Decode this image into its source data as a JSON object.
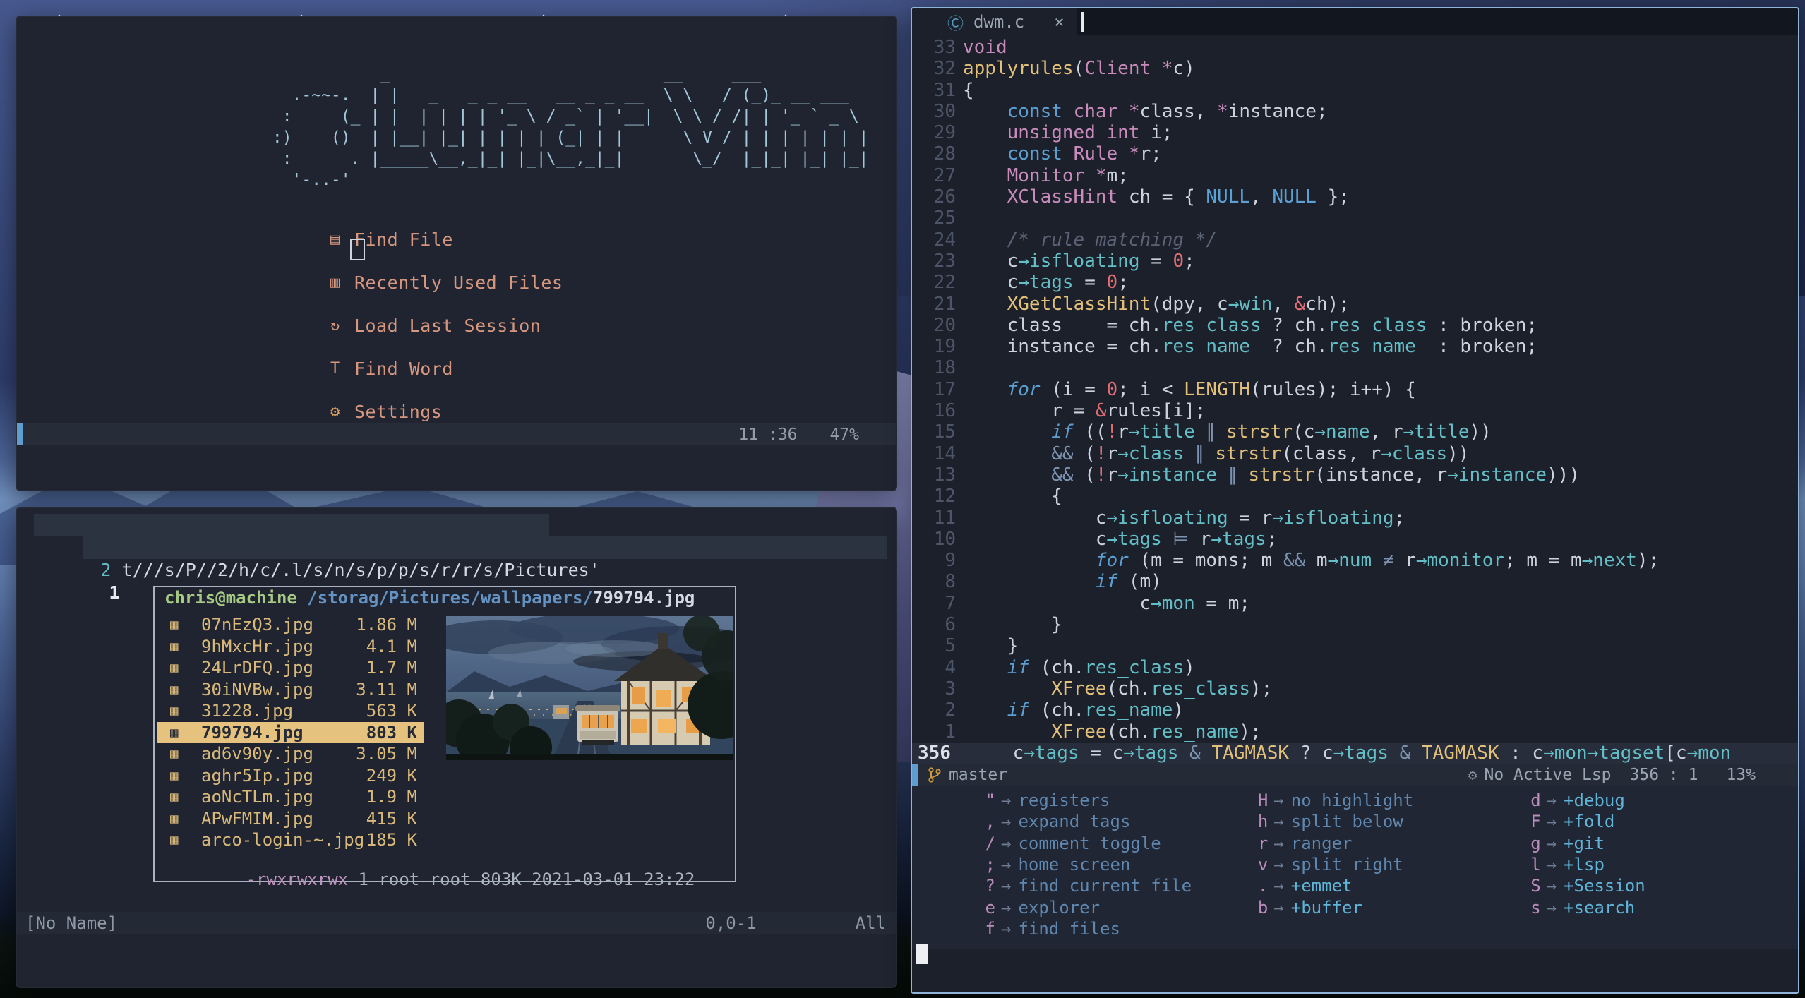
{
  "dashboard": {
    "art": "            _                            __     ___\n   .-~~-.  | |   _   _ _ __   __ _ _ __  \\ \\   / (_)_ __ ___\n  :     (_ | |  | | | | '_ \\ / _` | '__|  \\ \\ / /| | '_ ` _ \\\n :)    ()  | |__| |_| | | | | (_| | |      \\ V / | | | | | | |\n  :      . |_____\\__,_|_| |_|\\__,_|_|       \\_/  |_|_| |_| |_|\n   '-..-'",
    "menu": [
      {
        "id": "find-file",
        "icon": "▤",
        "label": "Find File"
      },
      {
        "id": "recent-files",
        "icon": "▥",
        "label": "Recently Used Files"
      },
      {
        "id": "load-session",
        "icon": "↻",
        "label": "Load Last Session"
      },
      {
        "id": "find-word",
        "icon": "T",
        "label": "Find Word"
      },
      {
        "id": "settings",
        "icon": "⚙",
        "label": "Settings",
        "icon_color": "#d9a05f"
      }
    ],
    "statusbar": {
      "time": "11 :36",
      "scroll": "47%"
    }
  },
  "terminal": {
    "row2": {
      "num": "2",
      "text": "t///s/P//2/h/c/.l/s/n/s/p/p/s/r/r/s/Pictures'"
    },
    "row1": {
      "num": "1"
    },
    "ranger": {
      "user": "chris@machine",
      "path": " /storag/Pictures/wallpapers/",
      "file": "799794.jpg",
      "file_icon": "▦",
      "entries": [
        {
          "name": "07nEzQ3.jpg",
          "size": "1.86 M"
        },
        {
          "name": "9hMxcHr.jpg",
          "size": "4.1 M"
        },
        {
          "name": "24LrDFQ.jpg",
          "size": "1.7 M"
        },
        {
          "name": "30iNVBw.jpg",
          "size": "3.11 M"
        },
        {
          "name": "31228.jpg",
          "size": "563 K"
        },
        {
          "name": "799794.jpg",
          "size": "803 K",
          "selected": true
        },
        {
          "name": "ad6v90y.jpg",
          "size": "3.05 M"
        },
        {
          "name": "aghr5Ip.jpg",
          "size": "249 K"
        },
        {
          "name": "aoNcTLm.jpg",
          "size": "1.9 M"
        },
        {
          "name": "APwFMIM.jpg",
          "size": "415 K"
        },
        {
          "name": "arco-login-~.jpg",
          "size": "185 K"
        }
      ],
      "info_perms": "-rwxrwxrwx",
      "info_rest": " 1 root root 803K 2021-03-01 23:22"
    },
    "statusline": {
      "name": "[No Name]",
      "pos": "0,0-1",
      "scroll": "All"
    }
  },
  "editor": {
    "tab": {
      "icon": "Ⓒ",
      "label": "dwm.c",
      "close": "×"
    },
    "lines": [
      {
        "n": "33",
        "t": [
          [
            "t",
            "void"
          ]
        ]
      },
      {
        "n": "32",
        "t": [
          [
            "y",
            "applyrules"
          ],
          [
            "f",
            "("
          ],
          [
            "t",
            "Client"
          ],
          [
            "f",
            " "
          ],
          [
            "t",
            "*"
          ],
          [
            "f",
            "c)"
          ]
        ]
      },
      {
        "n": "31",
        "t": [
          [
            "f",
            "{"
          ]
        ]
      },
      {
        "n": "30",
        "t": [
          [
            "f",
            "    "
          ],
          [
            "K",
            "const"
          ],
          [
            "f",
            " "
          ],
          [
            "t",
            "char"
          ],
          [
            "f",
            " "
          ],
          [
            "t",
            "*"
          ],
          [
            "f",
            "class, "
          ],
          [
            "t",
            "*"
          ],
          [
            "f",
            "instance;"
          ]
        ]
      },
      {
        "n": "29",
        "t": [
          [
            "f",
            "    "
          ],
          [
            "t",
            "unsigned int"
          ],
          [
            "f",
            " i;"
          ]
        ]
      },
      {
        "n": "28",
        "t": [
          [
            "f",
            "    "
          ],
          [
            "K",
            "const"
          ],
          [
            "f",
            " "
          ],
          [
            "t",
            "Rule"
          ],
          [
            "f",
            " "
          ],
          [
            "t",
            "*"
          ],
          [
            "f",
            "r;"
          ]
        ]
      },
      {
        "n": "27",
        "t": [
          [
            "f",
            "    "
          ],
          [
            "t",
            "Monitor"
          ],
          [
            "f",
            " "
          ],
          [
            "t",
            "*"
          ],
          [
            "f",
            "m;"
          ]
        ]
      },
      {
        "n": "26",
        "t": [
          [
            "f",
            "    "
          ],
          [
            "t",
            "XClassHint"
          ],
          [
            "f",
            " ch = { "
          ],
          [
            "K",
            "NULL"
          ],
          [
            "f",
            ", "
          ],
          [
            "K",
            "NULL"
          ],
          [
            "f",
            " };"
          ]
        ]
      },
      {
        "n": "25",
        "t": []
      },
      {
        "n": "24",
        "t": [
          [
            "f",
            "    "
          ],
          [
            "c",
            "/* rule matching */"
          ]
        ]
      },
      {
        "n": "23",
        "t": [
          [
            "f",
            "    c"
          ],
          [
            "p",
            "→isfloating"
          ],
          [
            "f",
            " = "
          ],
          [
            "n",
            "0"
          ],
          [
            "f",
            ";"
          ]
        ]
      },
      {
        "n": "22",
        "t": [
          [
            "f",
            "    c"
          ],
          [
            "p",
            "→tags"
          ],
          [
            "f",
            " = "
          ],
          [
            "n",
            "0"
          ],
          [
            "f",
            ";"
          ]
        ]
      },
      {
        "n": "21",
        "t": [
          [
            "f",
            "    "
          ],
          [
            "y",
            "XGetClassHint"
          ],
          [
            "f",
            "(dpy, c"
          ],
          [
            "p",
            "→win"
          ],
          [
            "f",
            ", "
          ],
          [
            "b",
            "&"
          ],
          [
            "f",
            "ch);"
          ]
        ]
      },
      {
        "n": "20",
        "t": [
          [
            "f",
            "    class    = ch."
          ],
          [
            "p",
            "res_class"
          ],
          [
            "f",
            " ? ch."
          ],
          [
            "p",
            "res_class"
          ],
          [
            "f",
            " : broken;"
          ]
        ]
      },
      {
        "n": "19",
        "t": [
          [
            "f",
            "    instance = ch."
          ],
          [
            "p",
            "res_name"
          ],
          [
            "f",
            "  ? ch."
          ],
          [
            "p",
            "res_name"
          ],
          [
            "f",
            "  : broken;"
          ]
        ]
      },
      {
        "n": "18",
        "t": []
      },
      {
        "n": "17",
        "t": [
          [
            "f",
            "    "
          ],
          [
            "k",
            "for"
          ],
          [
            "f",
            " (i = "
          ],
          [
            "n",
            "0"
          ],
          [
            "f",
            "; i < "
          ],
          [
            "y",
            "LENGTH"
          ],
          [
            "f",
            "(rules); i++) {"
          ]
        ]
      },
      {
        "n": "16",
        "t": [
          [
            "f",
            "        r = "
          ],
          [
            "b",
            "&"
          ],
          [
            "f",
            "rules[i];"
          ]
        ]
      },
      {
        "n": "15",
        "t": [
          [
            "f",
            "        "
          ],
          [
            "k",
            "if"
          ],
          [
            "f",
            " (("
          ],
          [
            "b",
            "!"
          ],
          [
            "f",
            "r"
          ],
          [
            "p",
            "→title"
          ],
          [
            "f",
            " "
          ],
          [
            "o",
            "∥"
          ],
          [
            "f",
            " "
          ],
          [
            "y",
            "strstr"
          ],
          [
            "f",
            "(c"
          ],
          [
            "p",
            "→name"
          ],
          [
            "f",
            ", r"
          ],
          [
            "p",
            "→title"
          ],
          [
            "f",
            "))"
          ]
        ]
      },
      {
        "n": "14",
        "t": [
          [
            "f",
            "        "
          ],
          [
            "o",
            "&&"
          ],
          [
            "f",
            " ("
          ],
          [
            "b",
            "!"
          ],
          [
            "f",
            "r"
          ],
          [
            "p",
            "→class"
          ],
          [
            "f",
            " "
          ],
          [
            "o",
            "∥"
          ],
          [
            "f",
            " "
          ],
          [
            "y",
            "strstr"
          ],
          [
            "f",
            "(class, r"
          ],
          [
            "p",
            "→class"
          ],
          [
            "f",
            "))"
          ]
        ]
      },
      {
        "n": "13",
        "t": [
          [
            "f",
            "        "
          ],
          [
            "o",
            "&&"
          ],
          [
            "f",
            " ("
          ],
          [
            "b",
            "!"
          ],
          [
            "f",
            "r"
          ],
          [
            "p",
            "→instance"
          ],
          [
            "f",
            " "
          ],
          [
            "o",
            "∥"
          ],
          [
            "f",
            " "
          ],
          [
            "y",
            "strstr"
          ],
          [
            "f",
            "(instance, r"
          ],
          [
            "p",
            "→instance"
          ],
          [
            "f",
            ")))"
          ]
        ]
      },
      {
        "n": "12",
        "t": [
          [
            "f",
            "        {"
          ]
        ]
      },
      {
        "n": "11",
        "t": [
          [
            "f",
            "            c"
          ],
          [
            "p",
            "→isfloating"
          ],
          [
            "f",
            " = r"
          ],
          [
            "p",
            "→isfloating"
          ],
          [
            "f",
            ";"
          ]
        ]
      },
      {
        "n": "10",
        "t": [
          [
            "f",
            "            c"
          ],
          [
            "p",
            "→tags"
          ],
          [
            "f",
            " "
          ],
          [
            "o",
            "⊨"
          ],
          [
            "f",
            " r"
          ],
          [
            "p",
            "→tags"
          ],
          [
            "f",
            ";"
          ]
        ]
      },
      {
        "n": "9",
        "t": [
          [
            "f",
            "            "
          ],
          [
            "k",
            "for"
          ],
          [
            "f",
            " (m = mons; m "
          ],
          [
            "o",
            "&&"
          ],
          [
            "f",
            " m"
          ],
          [
            "p",
            "→num"
          ],
          [
            "f",
            " "
          ],
          [
            "o",
            "≠"
          ],
          [
            "f",
            " r"
          ],
          [
            "p",
            "→monitor"
          ],
          [
            "f",
            "; m = m"
          ],
          [
            "p",
            "→next"
          ],
          [
            "f",
            ");"
          ]
        ]
      },
      {
        "n": "8",
        "t": [
          [
            "f",
            "            "
          ],
          [
            "k",
            "if"
          ],
          [
            "f",
            " (m)"
          ]
        ]
      },
      {
        "n": "7",
        "t": [
          [
            "f",
            "                c"
          ],
          [
            "p",
            "→mon"
          ],
          [
            "f",
            " = m;"
          ]
        ]
      },
      {
        "n": "6",
        "t": [
          [
            "f",
            "        }"
          ]
        ]
      },
      {
        "n": "5",
        "t": [
          [
            "f",
            "    }"
          ]
        ]
      },
      {
        "n": "4",
        "t": [
          [
            "f",
            "    "
          ],
          [
            "k",
            "if"
          ],
          [
            "f",
            " (ch."
          ],
          [
            "p",
            "res_class"
          ],
          [
            "f",
            ")"
          ]
        ]
      },
      {
        "n": "3",
        "t": [
          [
            "f",
            "        "
          ],
          [
            "y",
            "XFree"
          ],
          [
            "f",
            "(ch."
          ],
          [
            "p",
            "res_class"
          ],
          [
            "f",
            ");"
          ]
        ]
      },
      {
        "n": "2",
        "t": [
          [
            "f",
            "    "
          ],
          [
            "k",
            "if"
          ],
          [
            "f",
            " (ch."
          ],
          [
            "p",
            "res_name"
          ],
          [
            "f",
            ")"
          ]
        ]
      },
      {
        "n": "1",
        "t": [
          [
            "f",
            "        "
          ],
          [
            "y",
            "XFree"
          ],
          [
            "f",
            "(ch."
          ],
          [
            "p",
            "res_name"
          ],
          [
            "f",
            ");"
          ]
        ]
      },
      {
        "n": "356",
        "cur": true,
        "t": [
          [
            "f",
            "    c"
          ],
          [
            "p",
            "→tags"
          ],
          [
            "f",
            " = c"
          ],
          [
            "p",
            "→tags"
          ],
          [
            "f",
            " "
          ],
          [
            "o",
            "&"
          ],
          [
            "f",
            " "
          ],
          [
            "y",
            "TAGMASK"
          ],
          [
            "f",
            " ? c"
          ],
          [
            "p",
            "→tags"
          ],
          [
            "f",
            " "
          ],
          [
            "o",
            "&"
          ],
          [
            "f",
            " "
          ],
          [
            "y",
            "TAGMASK"
          ],
          [
            "f",
            " : c"
          ],
          [
            "p",
            "→mon"
          ],
          [
            "p",
            "→tagset"
          ],
          [
            "f",
            "[c"
          ],
          [
            "p",
            "→mon"
          ]
        ]
      }
    ],
    "statusline": {
      "branch": "master",
      "gear": "⚙",
      "lsp": "No Active Lsp",
      "pos": "356 : 1",
      "pct": "13%"
    },
    "whichkey": {
      "columns": [
        [
          {
            "key": "\"",
            "label": "registers"
          },
          {
            "key": ",",
            "label": "expand tags"
          },
          {
            "key": "/",
            "label": "comment toggle"
          },
          {
            "key": ";",
            "label": "home screen"
          },
          {
            "key": "?",
            "label": "find current file"
          },
          {
            "key": "e",
            "label": "explorer"
          },
          {
            "key": "f",
            "label": "find files"
          }
        ],
        [
          {
            "key": "H",
            "label": "no highlight"
          },
          {
            "key": "h",
            "label": "split below"
          },
          {
            "key": "r",
            "label": "ranger"
          },
          {
            "key": "v",
            "label": "split right"
          },
          {
            "key": ".",
            "label": "+emmet"
          },
          {
            "key": "b",
            "label": "+buffer"
          }
        ],
        [
          {
            "key": "d",
            "label": "+debug"
          },
          {
            "key": "F",
            "label": "+fold"
          },
          {
            "key": "g",
            "label": "+git"
          },
          {
            "key": "l",
            "label": "+lsp"
          },
          {
            "key": "S",
            "label": "+Session"
          },
          {
            "key": "s",
            "label": "+search"
          }
        ]
      ]
    }
  }
}
